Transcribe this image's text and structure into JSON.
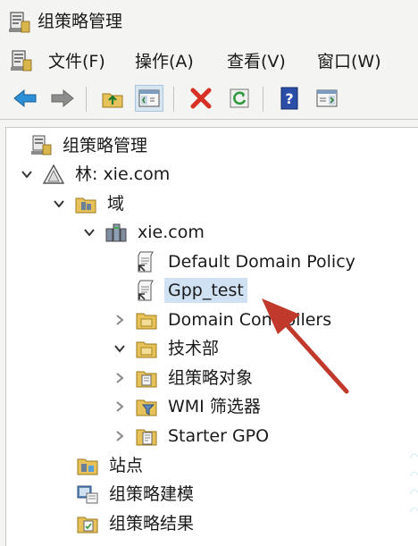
{
  "title": "组策略管理",
  "menu": [
    {
      "label": "文件(F)"
    },
    {
      "label": "操作(A)"
    },
    {
      "label": "查看(V)"
    },
    {
      "label": "窗口(W)"
    }
  ],
  "toolbar": [
    "back-icon",
    "forward-icon",
    "up-folder-icon",
    "show-hide-tree-icon",
    "delete-icon",
    "refresh-icon",
    "help-icon",
    "properties-icon"
  ],
  "tree": [
    {
      "label": "组策略管理",
      "icon": "gpmc-icon",
      "expand": "none"
    },
    {
      "label": "林: xie.com",
      "icon": "forest-icon",
      "expand": "expanded"
    },
    {
      "label": "域",
      "icon": "domains-folder-icon",
      "expand": "expanded"
    },
    {
      "label": "xie.com",
      "icon": "domain-icon",
      "expand": "expanded"
    },
    {
      "label": "Default Domain Policy",
      "icon": "gpo-link-icon",
      "expand": "none"
    },
    {
      "label": "Gpp_test",
      "icon": "gpo-link-icon",
      "expand": "none",
      "selected": true
    },
    {
      "label": "Domain Controllers",
      "icon": "ou-icon",
      "expand": "collapsed"
    },
    {
      "label": "技术部",
      "icon": "ou-icon",
      "expand": "expanded"
    },
    {
      "label": "组策略对象",
      "icon": "gpo-container-icon",
      "expand": "collapsed"
    },
    {
      "label": "WMI 筛选器",
      "icon": "wmi-filter-icon",
      "expand": "collapsed"
    },
    {
      "label": "Starter GPO",
      "icon": "starter-gpo-icon",
      "expand": "collapsed"
    },
    {
      "label": "站点",
      "icon": "sites-icon",
      "expand": "none"
    },
    {
      "label": "组策略建模",
      "icon": "modeling-icon",
      "expand": "none"
    },
    {
      "label": "组策略结果",
      "icon": "results-icon",
      "expand": "none"
    }
  ],
  "colors": {
    "selection": "#cfe1f3",
    "annotation_arrow": "#c0392b",
    "folder": "#e7c15a",
    "delete": "#d93025",
    "help": "#2b4fa8"
  }
}
